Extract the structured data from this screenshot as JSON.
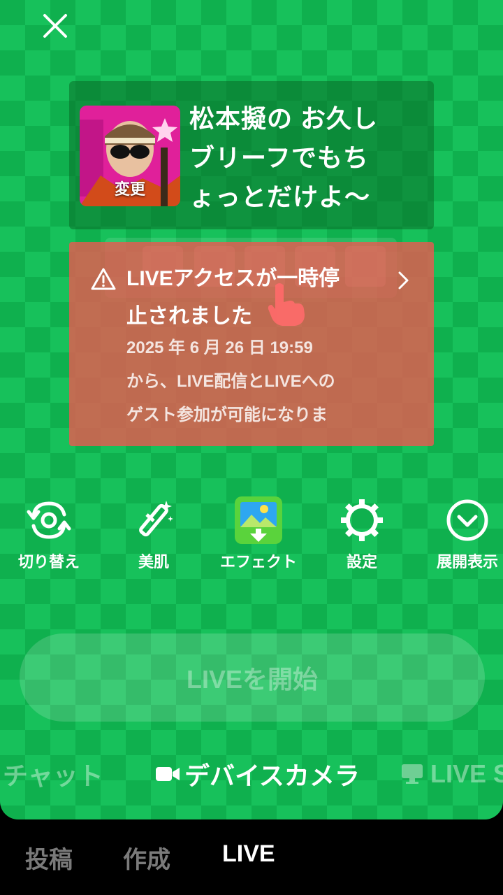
{
  "stream": {
    "thumbnail_label": "変更",
    "title_lines": [
      "松本擬の お久し",
      "ブリーフでもち",
      "ょっとだけよ〜"
    ]
  },
  "notice": {
    "title_lines": [
      "LIVEアクセスが一時停",
      "止されました"
    ],
    "body_lines": [
      "2025 年 6 月 26 日 19:59",
      "から、LIVE配信とLIVEへの",
      "ゲスト参加が可能になりま"
    ]
  },
  "toolbar": [
    {
      "label": "切り替え",
      "icon": "flip-camera-icon"
    },
    {
      "label": "美肌",
      "icon": "beauty-wand-icon"
    },
    {
      "label": "エフェクト",
      "icon": "effects-icon"
    },
    {
      "label": "設定",
      "icon": "gear-icon"
    },
    {
      "label": "展開表示",
      "icon": "chevron-down-circle-icon"
    }
  ],
  "start_button": "LIVEを開始",
  "mode_tabs": {
    "left": "チャット",
    "active": "デバイスカメラ",
    "right": "LIVE S"
  },
  "bottom_nav": [
    "投稿",
    "作成",
    "LIVE"
  ],
  "colors": {
    "background": "#0fb04e",
    "notice": "#e65a50",
    "active": "#ffffff"
  }
}
